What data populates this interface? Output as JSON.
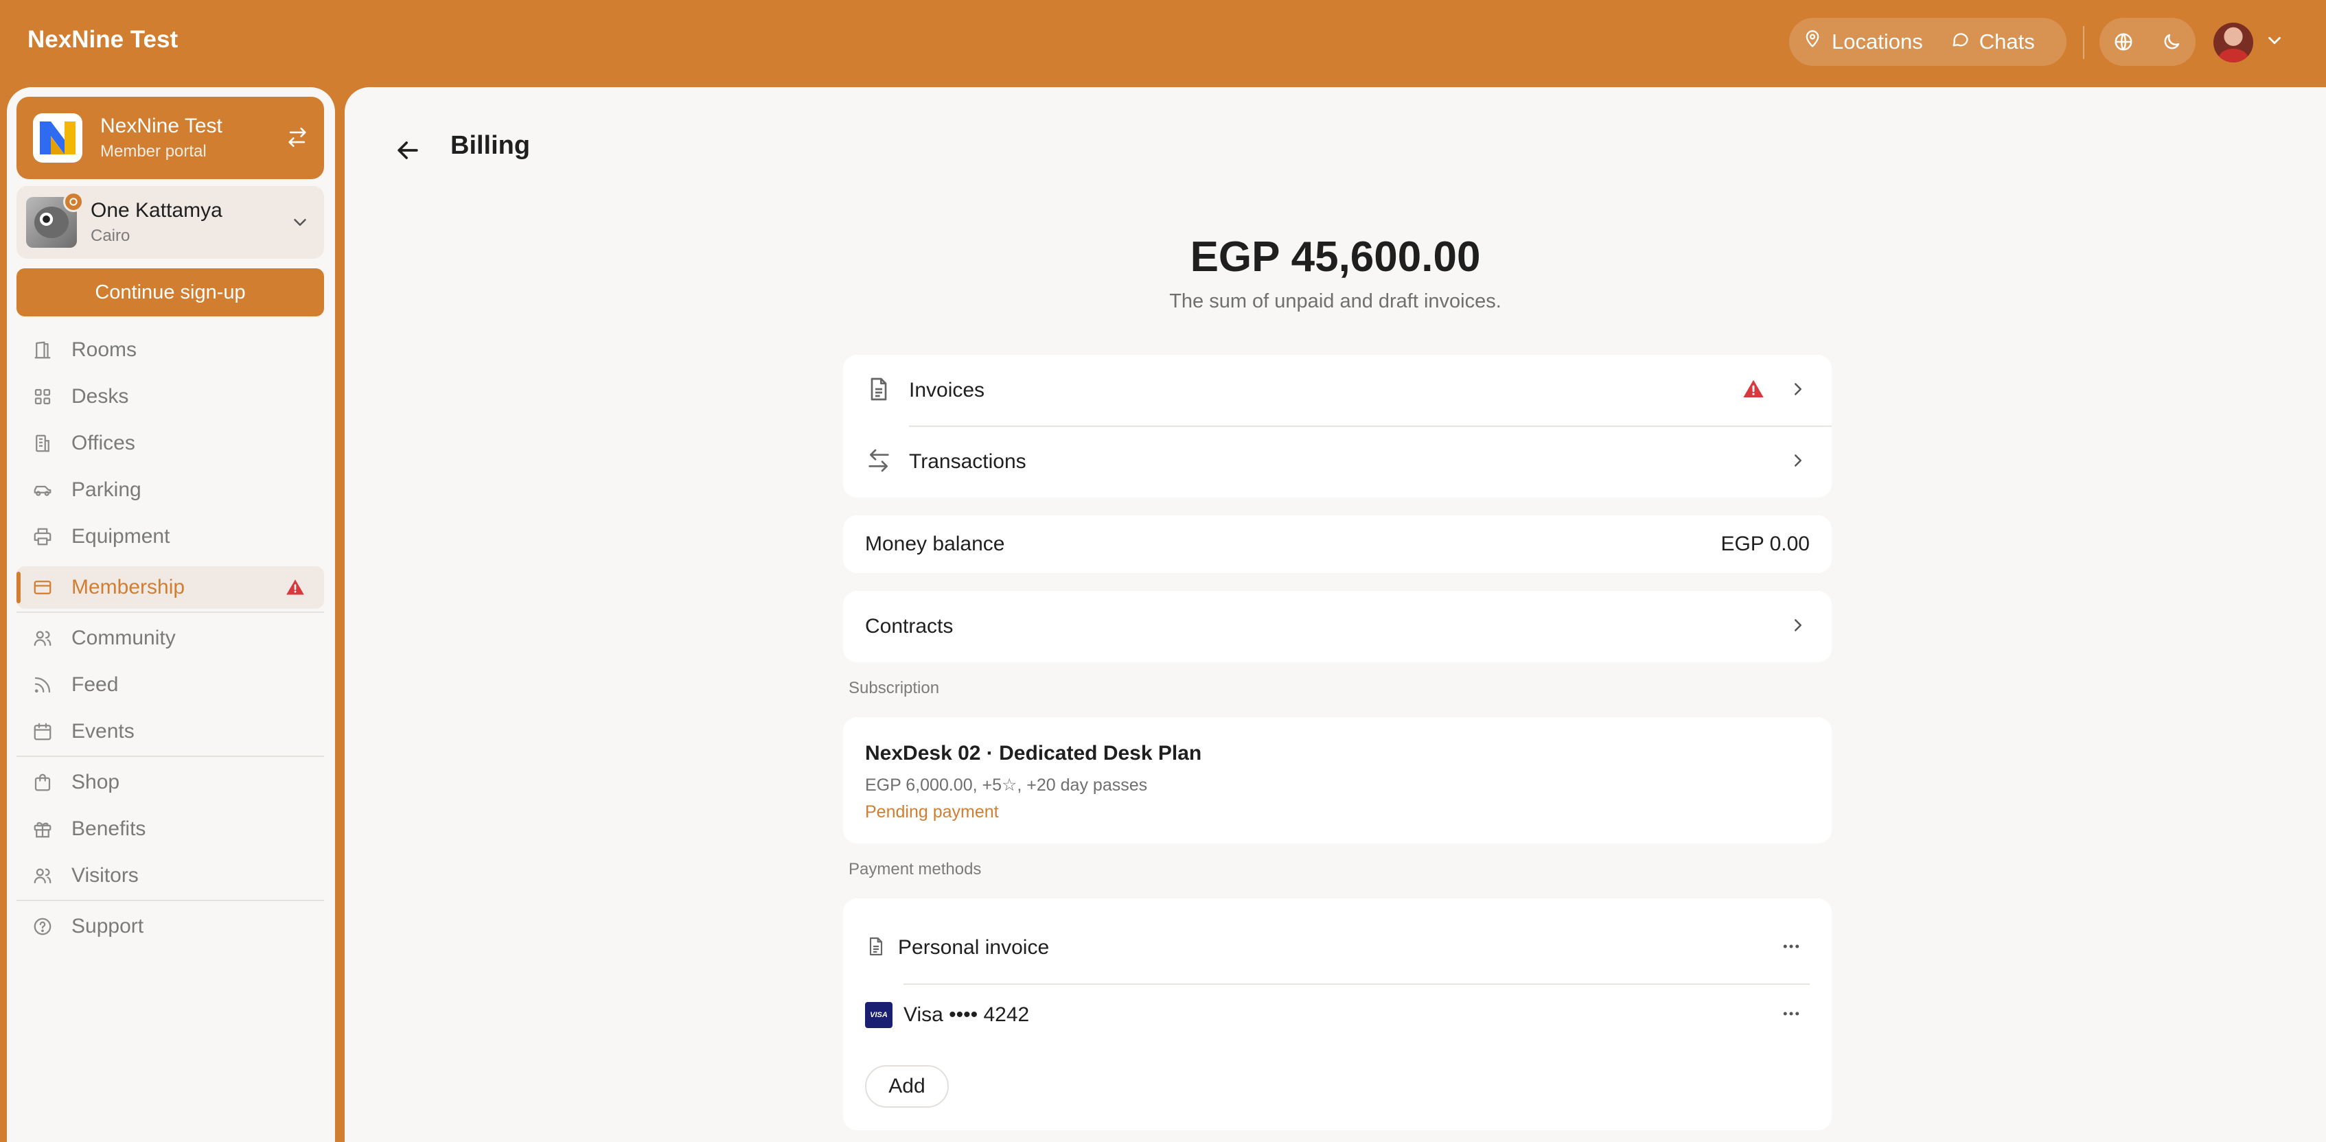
{
  "topbar": {
    "brand": "NexNine Test",
    "locations_label": "Locations",
    "chats_label": "Chats"
  },
  "sidebar": {
    "org_name": "NexNine Test",
    "org_subtitle": "Member portal",
    "location_name": "One Kattamya",
    "location_city": "Cairo",
    "signup_label": "Continue sign-up",
    "items": [
      {
        "label": "Rooms"
      },
      {
        "label": "Desks"
      },
      {
        "label": "Offices"
      },
      {
        "label": "Parking"
      },
      {
        "label": "Equipment"
      },
      {
        "label": "Membership"
      },
      {
        "label": "Community"
      },
      {
        "label": "Feed"
      },
      {
        "label": "Events"
      },
      {
        "label": "Shop"
      },
      {
        "label": "Benefits"
      },
      {
        "label": "Visitors"
      },
      {
        "label": "Support"
      }
    ]
  },
  "main": {
    "title": "Billing",
    "total": "EGP 45,600.00",
    "total_caption": "The sum of unpaid and draft invoices.",
    "invoices_label": "Invoices",
    "transactions_label": "Transactions",
    "money_balance_label": "Money balance",
    "money_balance_value": "EGP 0.00",
    "contracts_label": "Contracts",
    "subscription_section": "Subscription",
    "subscription": {
      "name": "NexDesk 02 · Dedicated Desk Plan",
      "details": "EGP 6,000.00, +5☆, +20 day passes",
      "status": "Pending payment"
    },
    "payment_section": "Payment methods",
    "payment_methods": [
      {
        "label": "Personal invoice"
      },
      {
        "label": "Visa •••• 4242",
        "badge": "VISA"
      }
    ],
    "add_label": "Add"
  },
  "colors": {
    "brand": "#d17e31",
    "warning": "#d9393e",
    "background": "#f8f7f5"
  }
}
